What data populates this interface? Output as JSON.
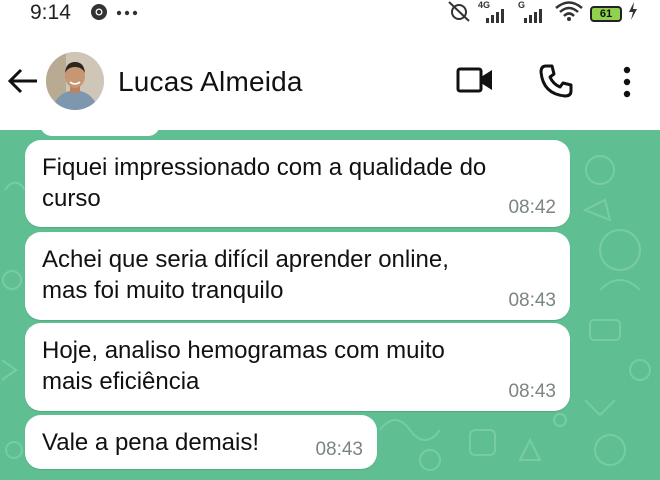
{
  "status_bar": {
    "time": "9:14",
    "left_icons": [
      "chrome-icon",
      "more-dots-icon"
    ],
    "network_label": "4G",
    "network_label_2": "G",
    "battery_level": "61"
  },
  "header": {
    "contact_name": "Lucas Almeida",
    "icons": {
      "back": "arrow-left-icon",
      "video": "video-camera-icon",
      "call": "phone-icon",
      "menu": "more-vertical-icon"
    }
  },
  "messages": [
    {
      "text": "Fiquei impressionado com a qualidade do\ncurso",
      "time": "08:42"
    },
    {
      "text": "Achei que seria difícil aprender online,\nmas foi muito tranquilo",
      "time": "08:43"
    },
    {
      "text": "Hoje, analiso hemogramas com muito\nmais eficiência",
      "time": "08:43"
    },
    {
      "text": "Vale a pena demais!",
      "time": "08:43"
    }
  ],
  "colors": {
    "chat_background": "#5fbf92",
    "bubble": "#ffffff",
    "timestamp": "#7a8580",
    "battery_fill": "#8ed24e"
  }
}
